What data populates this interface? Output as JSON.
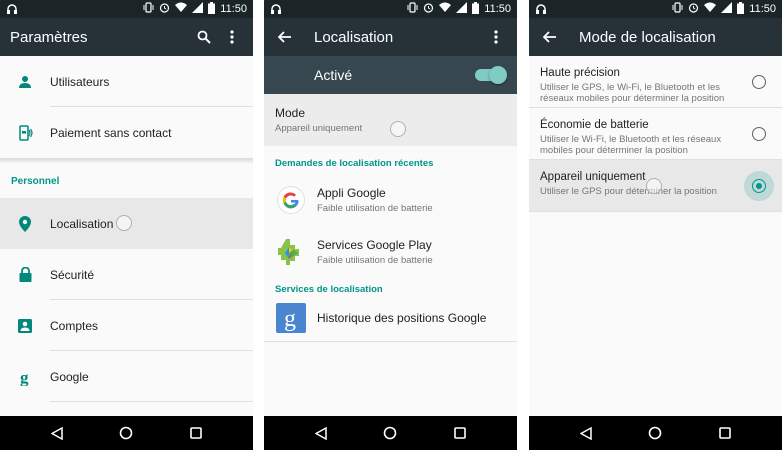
{
  "status": {
    "time": "11:50"
  },
  "panel1": {
    "title": "Paramètres",
    "items_top": [
      {
        "label": "Utilisateurs",
        "icon": "person-icon"
      },
      {
        "label": "Paiement sans contact",
        "icon": "nfc-payment-icon"
      }
    ],
    "section": "Personnel",
    "items_personal": [
      {
        "label": "Localisation",
        "icon": "location-pin-icon"
      },
      {
        "label": "Sécurité",
        "icon": "lock-icon"
      },
      {
        "label": "Comptes",
        "icon": "account-box-icon"
      },
      {
        "label": "Google",
        "icon": "google-g-icon"
      }
    ]
  },
  "panel2": {
    "title": "Localisation",
    "toggle_label": "Activé",
    "toggle_on": true,
    "mode": {
      "title": "Mode",
      "value": "Appareil uniquement"
    },
    "recent_header": "Demandes de localisation récentes",
    "recent": [
      {
        "name": "Appli Google",
        "detail": "Faible utilisation de batterie",
        "icon": "google-logo-icon"
      },
      {
        "name": "Services Google Play",
        "detail": "Faible utilisation de batterie",
        "icon": "play-services-icon"
      }
    ],
    "services_header": "Services de localisation",
    "services": [
      {
        "name": "Historique des positions Google",
        "icon": "google-g-tile-icon"
      }
    ]
  },
  "panel3": {
    "title": "Mode de localisation",
    "options": [
      {
        "title": "Haute précision",
        "desc": "Utiliser le GPS, le Wi-Fi, le Bluetooth et les réseaux mobiles pour déterminer la position",
        "selected": false
      },
      {
        "title": "Économie de batterie",
        "desc": "Utiliser le Wi-Fi, le Bluetooth et les réseaux mobiles pour déterminer la position",
        "selected": false
      },
      {
        "title": "Appareil uniquement",
        "desc": "Utiliser le GPS pour déterminer la position",
        "selected": true
      }
    ]
  },
  "colors": {
    "accent": "#009688",
    "appbar": "#263238",
    "statusbar": "#1b2528",
    "toggle_bar": "#37474f"
  }
}
